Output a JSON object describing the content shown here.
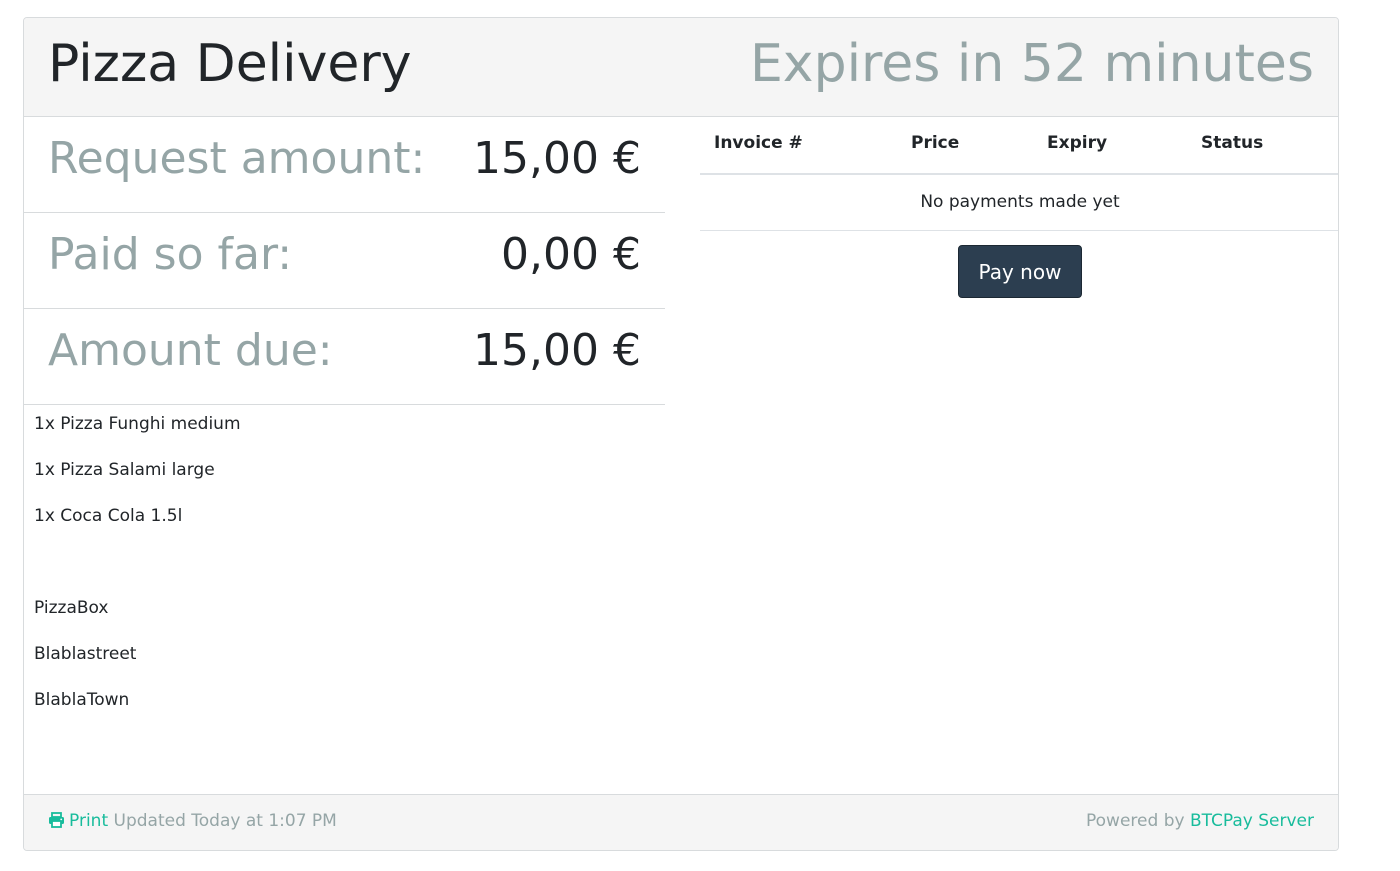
{
  "header": {
    "title": "Pizza Delivery",
    "expiry_text": "Expires in 52 minutes"
  },
  "amounts": [
    {
      "label": "Request amount:",
      "value": "15,00 €"
    },
    {
      "label": "Paid so far:",
      "value": "0,00 €"
    },
    {
      "label": "Amount due:",
      "value": "15,00 €"
    }
  ],
  "description": {
    "lines": [
      "1x Pizza Funghi medium",
      "1x Pizza Salami large",
      "1x Coca Cola 1.5l",
      "",
      "PizzaBox",
      "Blablastreet",
      "BlablaTown"
    ]
  },
  "invoices": {
    "columns": [
      "Invoice #",
      "Price",
      "Expiry",
      "Status"
    ],
    "empty_message": "No payments made yet",
    "pay_button": "Pay now"
  },
  "footer": {
    "print_label": "Print",
    "updated_text": "Updated Today at 1:07 PM",
    "powered_by": "Powered by",
    "brand_link": "BTCPay Server"
  },
  "colors": {
    "accent": "#18bc9c",
    "muted": "#95a5a6",
    "button": "#2c3e50"
  },
  "icons": {
    "print": "print-icon"
  }
}
